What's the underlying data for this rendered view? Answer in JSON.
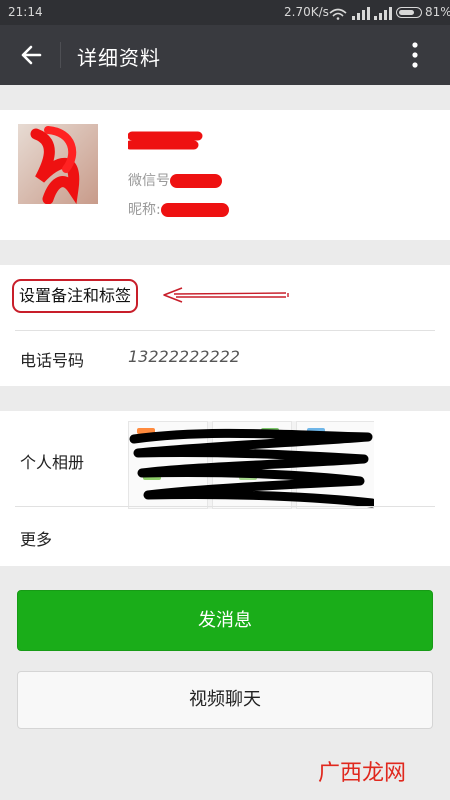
{
  "status_bar": {
    "time": "21:14",
    "speed": "2.70K/s",
    "battery_level": 0.81,
    "battery_text": "81%"
  },
  "header": {
    "title": "详细资料",
    "back_icon": "arrow-left-icon",
    "more_icon": "more-vertical-icon"
  },
  "profile": {
    "wechat_id_label": "微信号",
    "nickname_label": "昵称:"
  },
  "remark": {
    "label": "设置备注和标签"
  },
  "phone": {
    "label": "电话号码",
    "value": "13222222222"
  },
  "album": {
    "label": "个人相册"
  },
  "more": {
    "label": "更多"
  },
  "actions": {
    "send_message": "发消息",
    "video_chat": "视频聊天"
  },
  "watermark": {
    "text": "广西龙网"
  },
  "colors": {
    "primary_green": "#1aad19",
    "app_bar": "#393a3f",
    "annotation_red": "#c81e2a"
  }
}
